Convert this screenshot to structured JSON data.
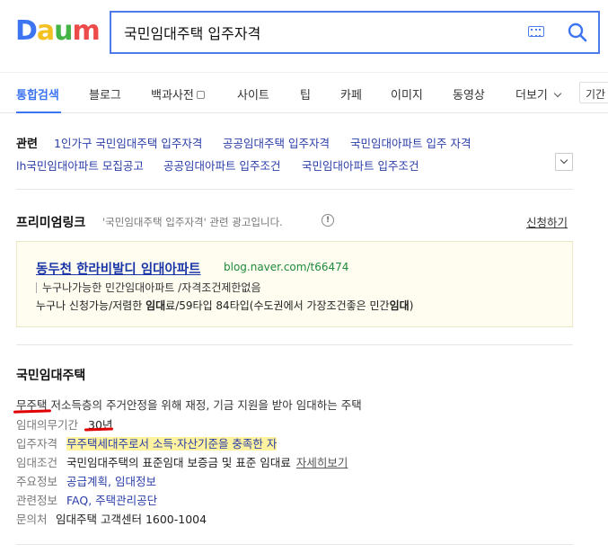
{
  "header": {
    "logo": {
      "letters": [
        "D",
        "a",
        "u",
        "m"
      ]
    },
    "search_value": "국민임대주택 입주자격",
    "colors": {
      "accent": "#3d74f2",
      "link": "#2a3ea8",
      "url": "#1e8a3c",
      "highlight": "#fff3a0"
    }
  },
  "tabs": {
    "items": [
      "통합검색",
      "블로그",
      "백과사전",
      "사이트",
      "팁",
      "카페",
      "이미지",
      "동영상",
      "더보기"
    ],
    "period": "기간"
  },
  "related": {
    "label": "관련",
    "items": [
      "1인가구 국민임대주택 입주자격",
      "공공임대주택 입주자격",
      "국민임대아파트 입주 자격",
      "lh국민임대아파트 모집공고",
      "공공임대아파트 입주조건",
      "국민임대아파트 입주조건"
    ]
  },
  "premium": {
    "title": "프리미엄링크",
    "desc": "'국민임대주택 입주자격' 관련 광고입니다.",
    "apply": "신청하기",
    "ad": {
      "title": "동두천 한라비발디 임대아파트",
      "url": "blog.naver.com/t66474",
      "line1": "누구나가능한 민간임대아파트 /자격조건제한없음",
      "line2_pre": "누구나 신청가능/저렴한 ",
      "line2_bold1": "임대",
      "line2_mid": "료/59타입 84타입(수도권에서 가장조건좋은 민간",
      "line2_bold2": "임대",
      "line2_post": ")"
    }
  },
  "dictionary": {
    "title": "국민임대주택",
    "definition": "무주택 저소득층의 주거안정을 위해 재정, 기금 지원을 받아 임대하는 주택",
    "rows": {
      "duty_label": "임대의무기간",
      "duty_value": "30년",
      "qual_label": "입주자격",
      "qual_value": "무주택세대주로서 소득·자산기준을 충족한 자",
      "cond_label": "임대조건",
      "cond_value": "국민임대주택의 표준임대 보증금 및 표준 임대료",
      "cond_more": "자세히보기",
      "info_label": "주요정보",
      "info_value": "공급계획, 임대정보",
      "rel_label": "관련정보",
      "rel_value": "FAQ, 주택관리공단",
      "contact_label": "문의처",
      "contact_value": "임대주택 고객센터  1600-1004"
    }
  }
}
